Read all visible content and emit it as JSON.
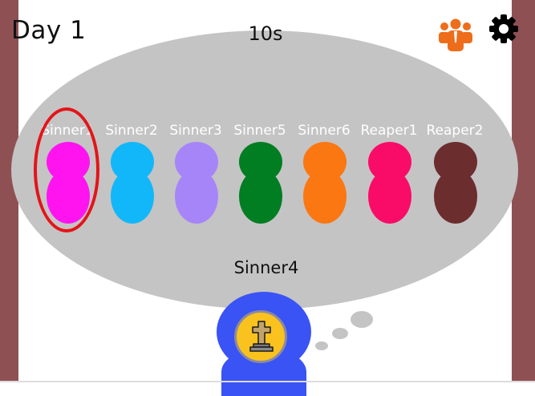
{
  "hud": {
    "day_label": "Day 1",
    "timer": "10s",
    "players_icon": "players-group-icon",
    "settings_icon": "gear-icon",
    "players_icon_color": "#ee6d1b"
  },
  "characters": [
    {
      "name": "Sinner1",
      "color": "#ff14f0",
      "selected": true
    },
    {
      "name": "Sinner2",
      "color": "#11b7f9",
      "selected": false
    },
    {
      "name": "Sinner3",
      "color": "#a685f9",
      "selected": false
    },
    {
      "name": "Sinner5",
      "color": "#017d22",
      "selected": false
    },
    {
      "name": "Sinner6",
      "color": "#fb7712",
      "selected": false
    },
    {
      "name": "Reaper1",
      "color": "#f90c68",
      "selected": false
    },
    {
      "name": "Reaper2",
      "color": "#6c2d2f",
      "selected": false
    }
  ],
  "speaker": {
    "name": "Sinner4",
    "color": "#3a53f4",
    "status_icon": "grave-cross-icon",
    "status_bg": "#f9c21e"
  },
  "colors": {
    "wall": "#8e5053",
    "bubble": "#c4c4c4",
    "selection_ring": "#e4141a"
  }
}
